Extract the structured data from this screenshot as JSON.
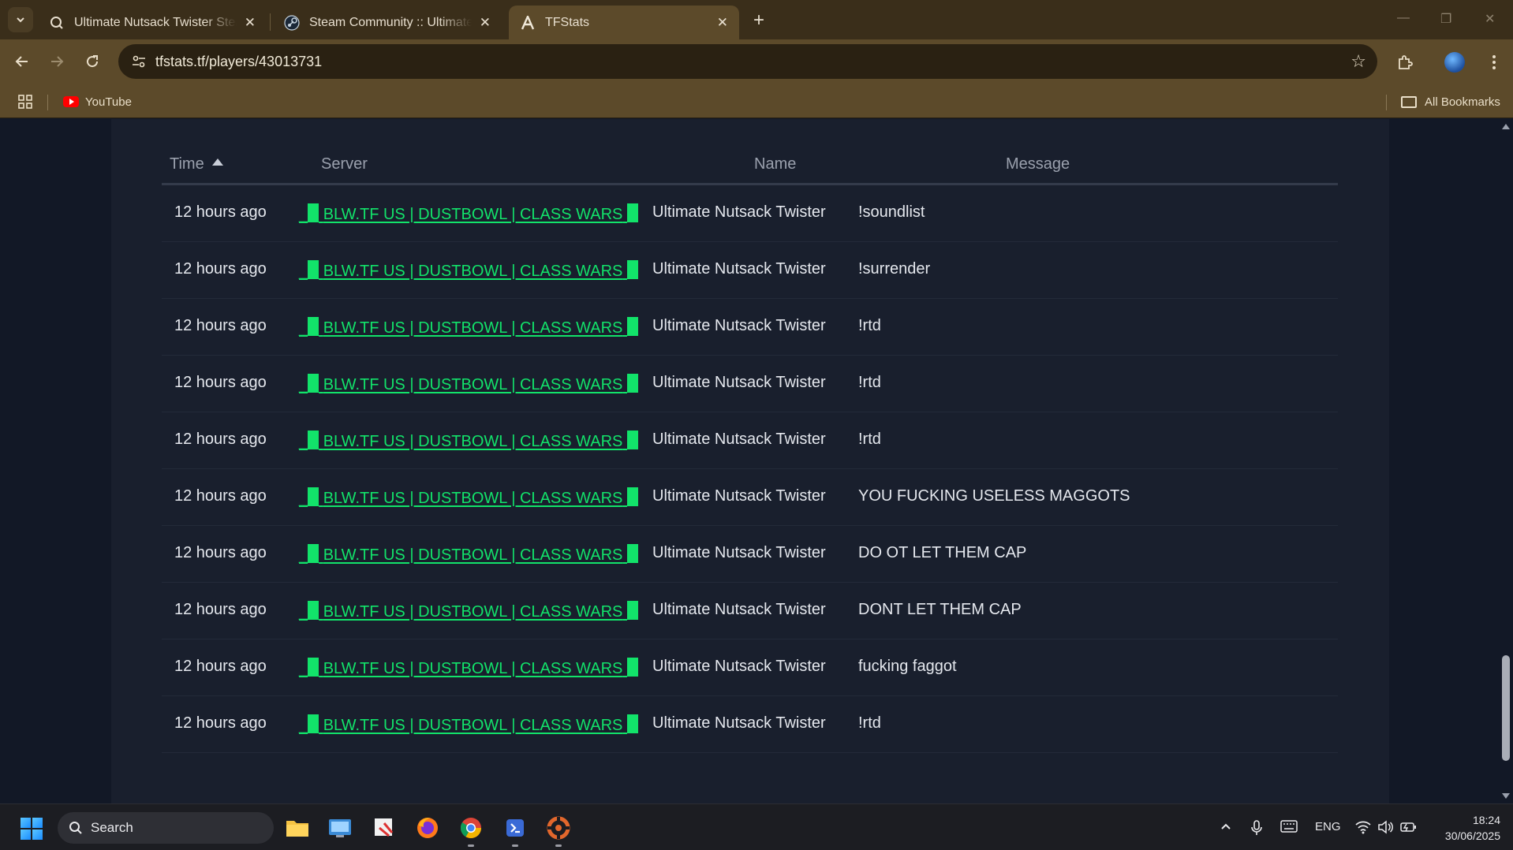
{
  "browser": {
    "tabs": [
      {
        "title": "Ultimate Nutsack Twister Steam",
        "active": false
      },
      {
        "title": "Steam Community :: Ultimate N",
        "active": false
      },
      {
        "title": "TFStats",
        "active": true
      }
    ],
    "url": "tfstats.tf/players/43013731",
    "bookmarks": [
      {
        "label": "YouTube"
      }
    ],
    "all_bookmarks_label": "All Bookmarks"
  },
  "table": {
    "columns": {
      "time": "Time",
      "server": "Server",
      "name": "Name",
      "message": "Message"
    },
    "rows": [
      {
        "time": "12 hours ago",
        "server": "_",
        "server_text": "BLW.TF US | DUSTBOWL | CLASS WARS",
        "name": "Ultimate Nutsack Twister",
        "message": "!soundlist"
      },
      {
        "time": "12 hours ago",
        "server": "_",
        "server_text": "BLW.TF US | DUSTBOWL | CLASS WARS",
        "name": "Ultimate Nutsack Twister",
        "message": "!surrender"
      },
      {
        "time": "12 hours ago",
        "server": "_",
        "server_text": "BLW.TF US | DUSTBOWL | CLASS WARS",
        "name": "Ultimate Nutsack Twister",
        "message": "!rtd"
      },
      {
        "time": "12 hours ago",
        "server": "_",
        "server_text": "BLW.TF US | DUSTBOWL | CLASS WARS",
        "name": "Ultimate Nutsack Twister",
        "message": "!rtd"
      },
      {
        "time": "12 hours ago",
        "server": "_",
        "server_text": "BLW.TF US | DUSTBOWL | CLASS WARS",
        "name": "Ultimate Nutsack Twister",
        "message": "!rtd"
      },
      {
        "time": "12 hours ago",
        "server": "_",
        "server_text": "BLW.TF US | DUSTBOWL | CLASS WARS",
        "name": "Ultimate Nutsack Twister",
        "message": "YOU FUCKING USELESS MAGGOTS"
      },
      {
        "time": "12 hours ago",
        "server": "_",
        "server_text": "BLW.TF US | DUSTBOWL | CLASS WARS",
        "name": "Ultimate Nutsack Twister",
        "message": "DO OT LET THEM CAP"
      },
      {
        "time": "12 hours ago",
        "server": "_",
        "server_text": "BLW.TF US | DUSTBOWL | CLASS WARS",
        "name": "Ultimate Nutsack Twister",
        "message": "DONT LET THEM CAP"
      },
      {
        "time": "12 hours ago",
        "server": "_",
        "server_text": "BLW.TF US | DUSTBOWL | CLASS WARS",
        "name": "Ultimate Nutsack Twister",
        "message": "fucking faggot"
      },
      {
        "time": "12 hours ago",
        "server": "_",
        "server_text": "BLW.TF US | DUSTBOWL | CLASS WARS",
        "name": "Ultimate Nutsack Twister",
        "message": "!rtd"
      }
    ]
  },
  "colors": {
    "server_link": "#12e36a",
    "background": "#121826",
    "card": "#191f2d"
  },
  "taskbar": {
    "search_label": "Search",
    "language": "ENG",
    "time": "18:24",
    "date": "30/06/2025"
  }
}
